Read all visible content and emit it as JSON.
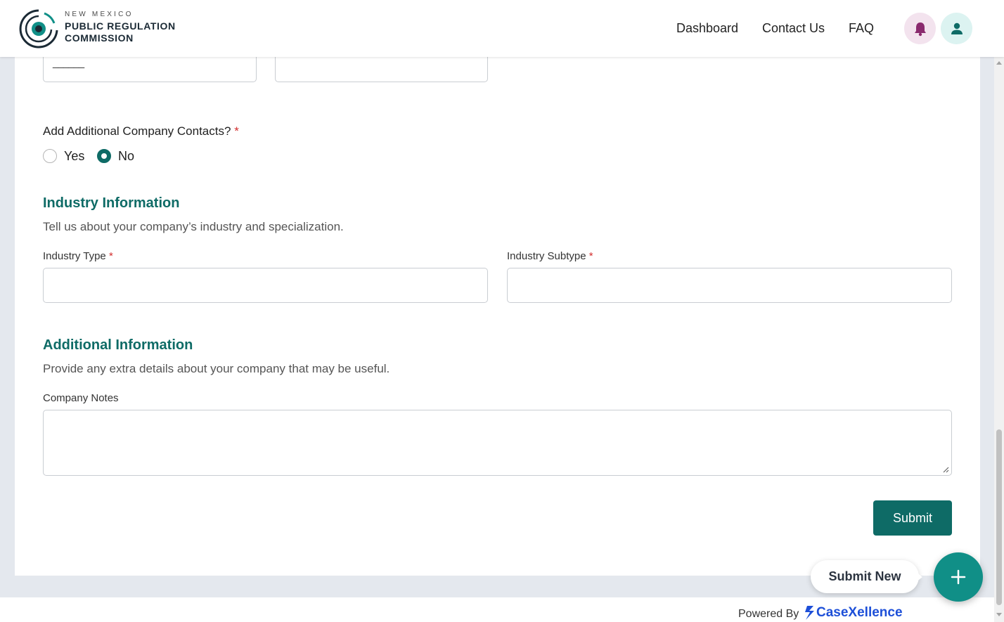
{
  "brand": {
    "line1": "NEW MEXICO",
    "line2": "PUBLIC REGULATION",
    "line3": "COMMISSION",
    "colors": {
      "teal": "#0e6b66",
      "dark": "#1b2a35"
    }
  },
  "nav": {
    "dashboard": "Dashboard",
    "contact": "Contact Us",
    "faq": "FAQ",
    "icons": [
      "bell-icon",
      "user-icon"
    ]
  },
  "form": {
    "top_field_1_value": "______",
    "top_field_2_value": "",
    "contacts_question": "Add Additional Company Contacts?",
    "required_mark": "*",
    "radio_yes": "Yes",
    "radio_no": "No",
    "selected_option": "No",
    "industry": {
      "title": "Industry Information",
      "description": "Tell us about your company’s industry and specialization.",
      "type_label": "Industry Type",
      "type_value": "",
      "subtype_label": "Industry Subtype",
      "subtype_value": ""
    },
    "additional": {
      "title": "Additional Information",
      "description": "Provide any extra details about your company that may be useful.",
      "notes_label": "Company Notes",
      "notes_value": ""
    },
    "submit_label": "Submit"
  },
  "floating": {
    "submit_new_label": "Submit New",
    "fab_icon": "plus-icon"
  },
  "footer": {
    "powered_by": "Powered By",
    "provider": "CaseXellence",
    "provider_color": "#1d4fd8"
  }
}
